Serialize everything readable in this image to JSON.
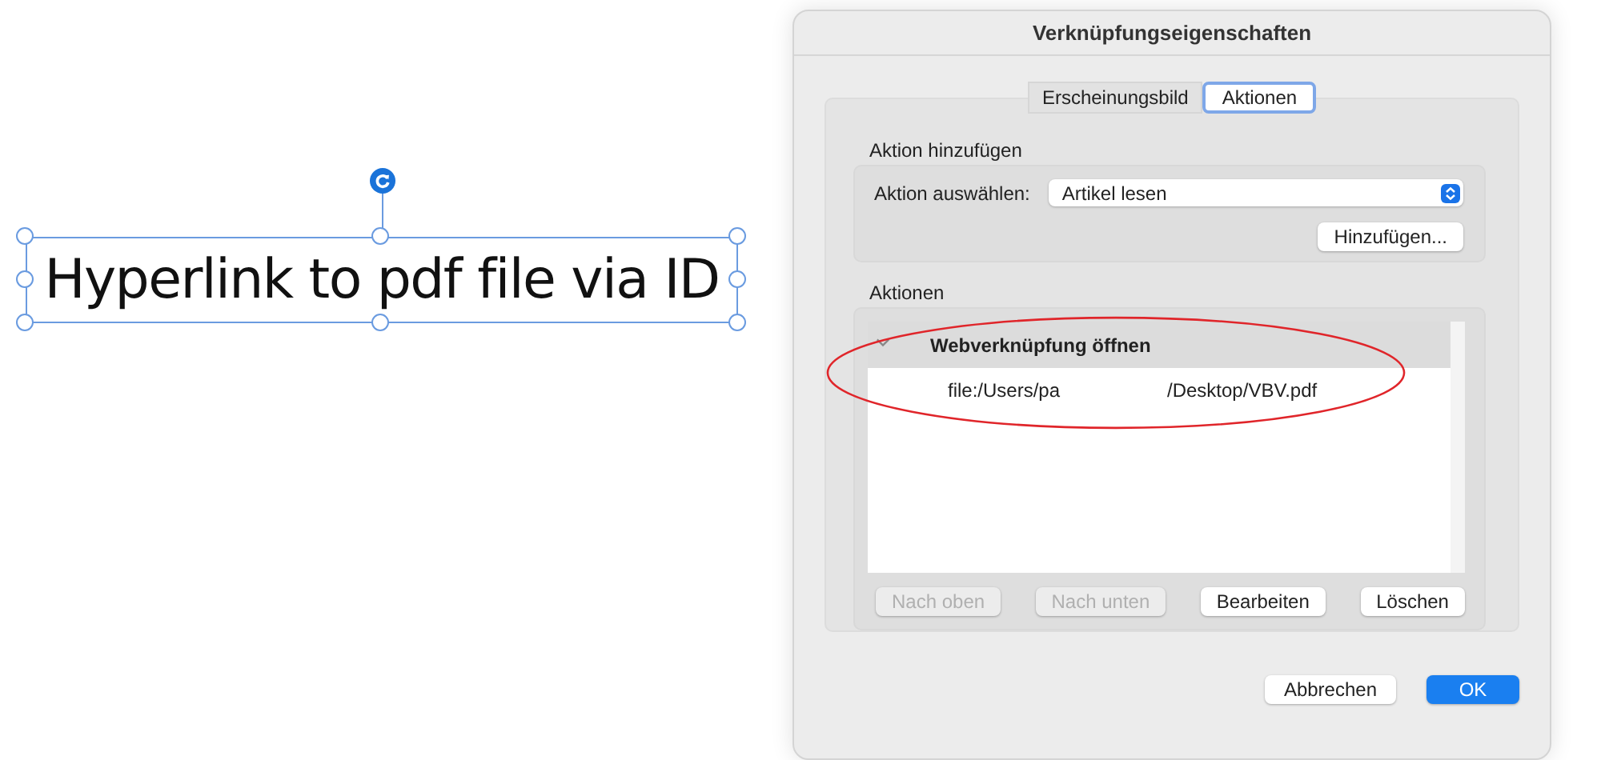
{
  "canvas": {
    "text_frame": {
      "text": "Hyperlink to pdf file via ID",
      "selected": true
    }
  },
  "dialog": {
    "title": "Verknüpfungseigenschaften",
    "tabs": [
      {
        "label": "Erscheinungsbild",
        "selected": false
      },
      {
        "label": "Aktionen",
        "selected": true
      }
    ],
    "add_action": {
      "heading": "Aktion hinzufügen",
      "select_label": "Aktion auswählen:",
      "select_value": "Artikel lesen",
      "add_button": "Hinzufügen..."
    },
    "actions": {
      "heading": "Aktionen",
      "items": [
        {
          "label": "Webverknüpfung öffnen",
          "expanded": true,
          "children": [
            {
              "path_parts": [
                "file:/Users/pa",
                "/Desktop/VBV.pdf"
              ]
            }
          ]
        }
      ],
      "buttons": [
        {
          "label": "Nach oben",
          "disabled": true
        },
        {
          "label": "Nach unten",
          "disabled": true
        },
        {
          "label": "Bearbeiten",
          "disabled": false
        },
        {
          "label": "Löschen",
          "disabled": false
        }
      ]
    },
    "footer_buttons": [
      {
        "label": "Abbrechen",
        "kind": "cancel"
      },
      {
        "label": "OK",
        "kind": "default"
      }
    ]
  }
}
